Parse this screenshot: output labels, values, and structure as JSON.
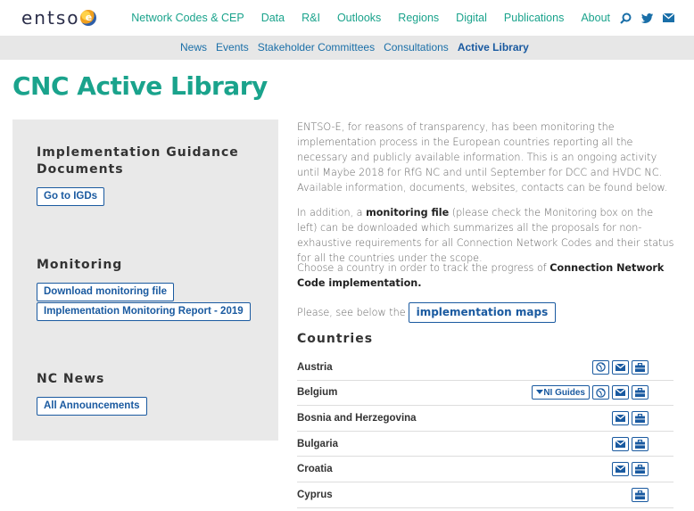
{
  "brand": {
    "logo_text": "entso",
    "logo_e": "e"
  },
  "main_nav": {
    "items": [
      "Network Codes & CEP",
      "Data",
      "R&I",
      "Outlooks",
      "Regions",
      "Digital",
      "Publications",
      "About"
    ],
    "icons": [
      "search-icon",
      "twitter-icon",
      "mail-icon"
    ]
  },
  "sub_nav": {
    "items": [
      "News",
      "Events",
      "Stakeholder Committees",
      "Consultations"
    ],
    "active": "Active Library"
  },
  "page": {
    "title": "CNC Active Library"
  },
  "sidebar": {
    "igd_heading_line1": "Implementation Guidance",
    "igd_heading_line2": "Documents",
    "igd_button": "Go to IGDs",
    "monitoring_heading": "Monitoring",
    "download_button": "Download monitoring file",
    "report_button": "Implementation Monitoring Report - 2019",
    "news_heading": "NC News",
    "announcements_button": "All Announcements"
  },
  "content": {
    "p1": "ENTSO-E, for reasons of transparency, has been monitoring the implementation process in the European countries reporting all the necessary and publicly available information. This is an ongoing activity until Maybe 2018 for RfG NC and until September for DCC and HVDC NC. Available information, documents, websites, contacts can be found below.",
    "p2_pre": "In addition, a ",
    "p2_bold": "monitoring file",
    "p2_post": " (please check the Monitoring box on the left) can be downloaded which summarizes all the proposals for non-exhaustive requirements for all Connection Network Codes and their status for all the countries under the scope.",
    "p3_pre": "Choose a country in order to track the progress of ",
    "p3_bold": "Connection Network Code implementation.",
    "p4_text": "Please, see below the",
    "maps_button": "implementation maps",
    "countries_heading": "Countries",
    "ni_guides_label": "NI Guides",
    "countries": [
      {
        "name": "Austria",
        "icons": [
          "globe-icon",
          "mail-icon",
          "briefcase-icon"
        ]
      },
      {
        "name": "Belgium",
        "ni_guides": true,
        "icons": [
          "globe-icon",
          "mail-icon",
          "briefcase-icon"
        ]
      },
      {
        "name": "Bosnia and Herzegovina",
        "icons": [
          "mail-icon",
          "briefcase-icon"
        ]
      },
      {
        "name": "Bulgaria",
        "icons": [
          "mail-icon",
          "briefcase-icon"
        ]
      },
      {
        "name": "Croatia",
        "icons": [
          "mail-icon",
          "briefcase-icon"
        ]
      },
      {
        "name": "Cyprus",
        "icons": [
          "briefcase-icon"
        ]
      }
    ]
  },
  "colors": {
    "accent_teal": "#1aa38c",
    "link_blue": "#1a5aa0",
    "sidebar_bg": "#e9e9e9"
  }
}
